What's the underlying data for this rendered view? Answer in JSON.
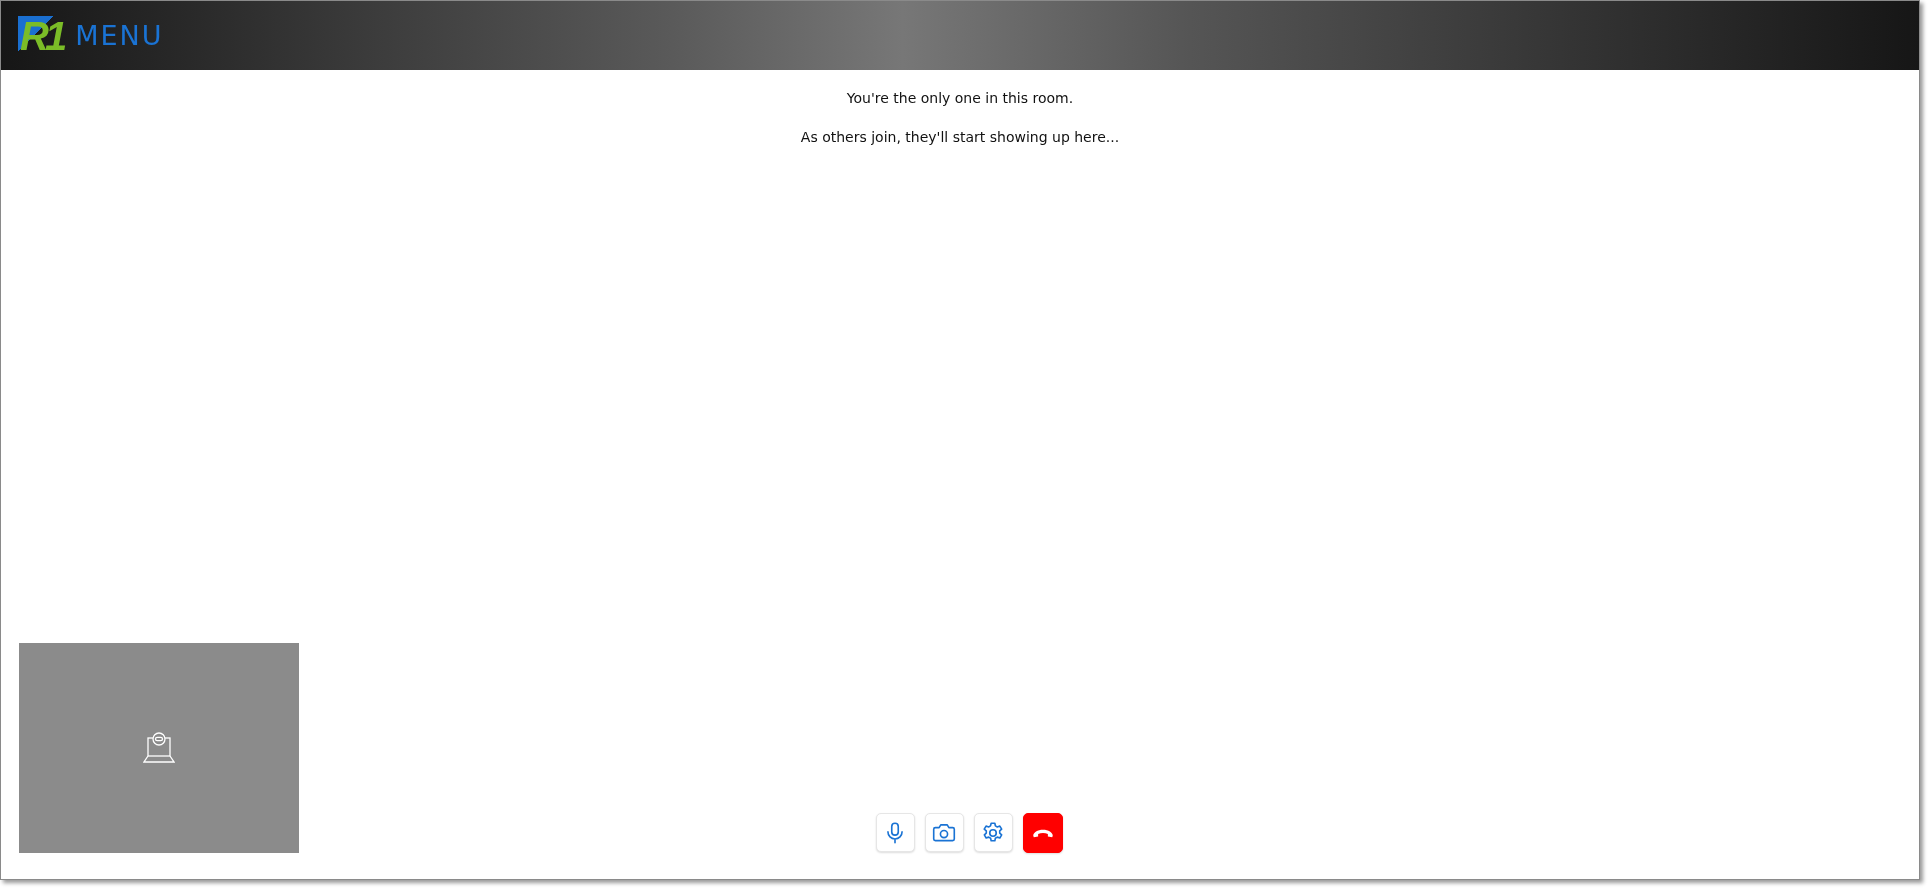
{
  "header": {
    "logo_mark": "R1",
    "logo_text": "MENU"
  },
  "messages": [
    "You're the only one in this room.",
    "As others join, they'll start showing up here..."
  ],
  "controls": [
    {
      "kind": "mic"
    },
    {
      "kind": "camera"
    },
    {
      "kind": "settings"
    },
    {
      "kind": "hangup"
    }
  ]
}
